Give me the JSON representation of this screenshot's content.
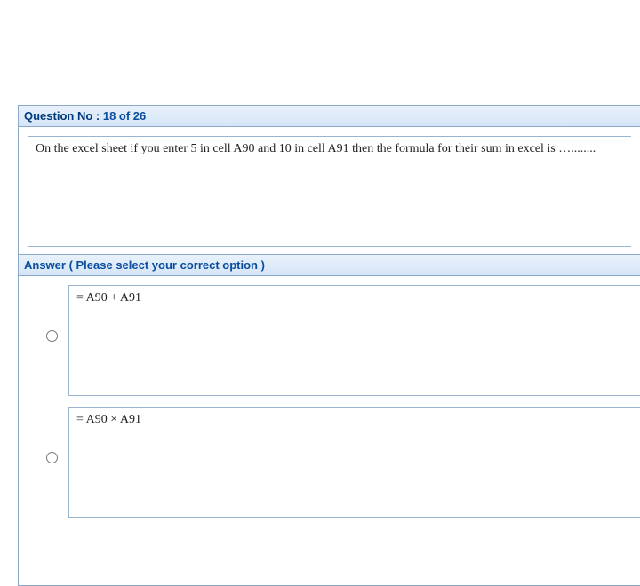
{
  "header": {
    "label": "Question No :",
    "progress": "18 of 26"
  },
  "question": {
    "text": "On the excel sheet if you enter 5 in cell A90 and 10 in cell A91 then the formula for their sum in excel is …........"
  },
  "answer_header": "Answer ( Please select your correct option )",
  "options": [
    {
      "text": "= A90 + A91"
    },
    {
      "text": "= A90 × A91"
    }
  ]
}
